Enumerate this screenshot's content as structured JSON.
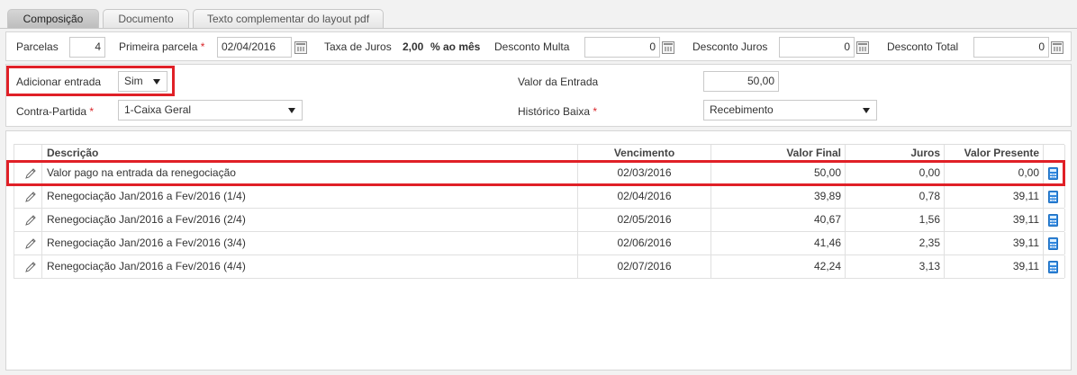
{
  "tabs": [
    "Composição",
    "Documento",
    "Texto complementar do layout pdf"
  ],
  "top": {
    "parcelas_label": "Parcelas",
    "parcelas_value": "4",
    "primeira_parcela_label": "Primeira parcela",
    "primeira_parcela_value": "02/04/2016",
    "taxa_label": "Taxa de Juros",
    "taxa_value": "2,00",
    "taxa_unit": "% ao mês",
    "desconto_multa_label": "Desconto Multa",
    "desconto_multa_value": "0",
    "desconto_juros_label": "Desconto Juros",
    "desconto_juros_value": "0",
    "desconto_total_label": "Desconto Total",
    "desconto_total_value": "0",
    "required_mark": "*"
  },
  "entrada": {
    "adicionar_label": "Adicionar entrada",
    "adicionar_value": "Sim",
    "valor_label": "Valor da Entrada",
    "valor_value": "50,00",
    "contra_label": "Contra-Partida",
    "contra_value": "1-Caixa Geral",
    "historico_label": "Histórico Baixa",
    "historico_value": "Recebimento"
  },
  "table": {
    "headers": {
      "descricao": "Descrição",
      "vencimento": "Vencimento",
      "valor_final": "Valor Final",
      "juros": "Juros",
      "valor_presente": "Valor Presente"
    },
    "rows": [
      {
        "descricao": "Valor pago na entrada da renegociação",
        "vencimento": "02/03/2016",
        "valor_final": "50,00",
        "juros": "0,00",
        "valor_presente": "0,00"
      },
      {
        "descricao": "Renegociação Jan/2016 a Fev/2016 (1/4)",
        "vencimento": "02/04/2016",
        "valor_final": "39,89",
        "juros": "0,78",
        "valor_presente": "39,11"
      },
      {
        "descricao": "Renegociação Jan/2016 a Fev/2016 (2/4)",
        "vencimento": "02/05/2016",
        "valor_final": "40,67",
        "juros": "1,56",
        "valor_presente": "39,11"
      },
      {
        "descricao": "Renegociação Jan/2016 a Fev/2016 (3/4)",
        "vencimento": "02/06/2016",
        "valor_final": "41,46",
        "juros": "2,35",
        "valor_presente": "39,11"
      },
      {
        "descricao": "Renegociação Jan/2016 a Fev/2016 (4/4)",
        "vencimento": "02/07/2016",
        "valor_final": "42,24",
        "juros": "3,13",
        "valor_presente": "39,11"
      }
    ]
  },
  "icons": {
    "edit": "pencil-icon",
    "calc": "calculator-icon",
    "calendar": "calendar-icon",
    "dropdown": "chevron-down-icon"
  },
  "colors": {
    "highlight": "#e02027",
    "required": "#d9262a",
    "calc_icon": "#2e86de",
    "active_tab": "#c4c4c4"
  }
}
